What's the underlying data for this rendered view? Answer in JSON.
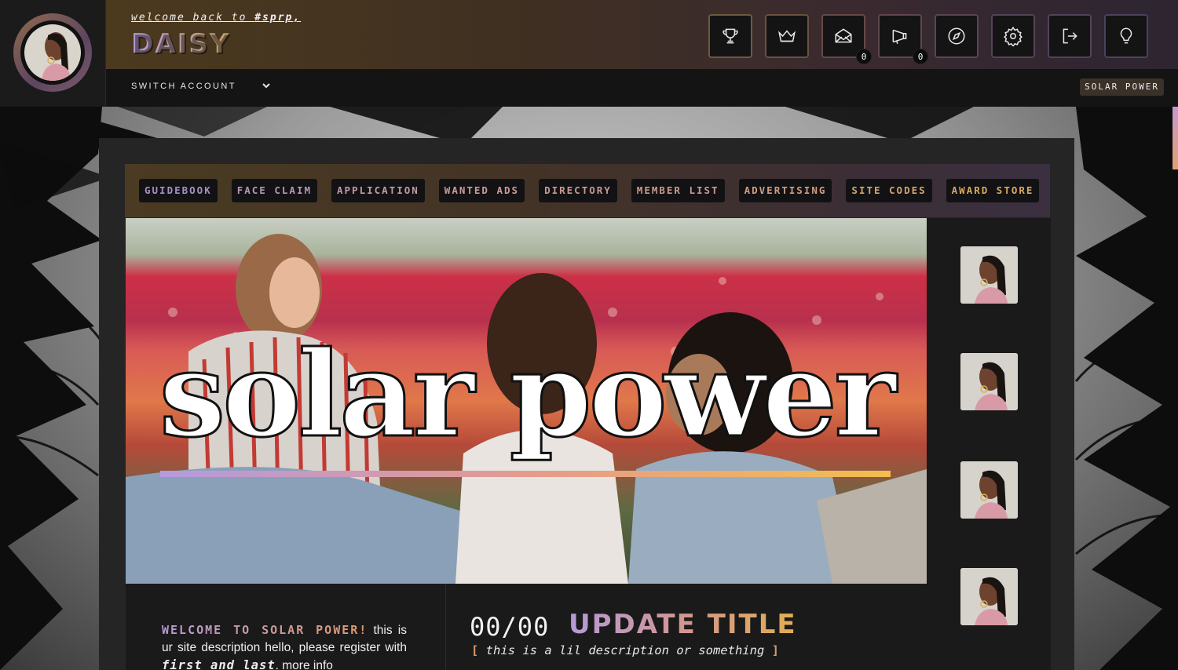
{
  "header": {
    "welcome_prefix": "welcome back to",
    "welcome_site": "#sprp,",
    "username": "DAISY",
    "switch_account": "SWITCH ACCOUNT",
    "site_tag": "SOLAR POWER",
    "icons": [
      {
        "name": "trophy-icon"
      },
      {
        "name": "crown-icon"
      },
      {
        "name": "mail-icon",
        "badge": "0"
      },
      {
        "name": "megaphone-icon",
        "badge": "0"
      },
      {
        "name": "compass-icon"
      },
      {
        "name": "gear-icon"
      },
      {
        "name": "logout-icon"
      },
      {
        "name": "lightbulb-icon"
      }
    ]
  },
  "nav": {
    "items": [
      {
        "label": "GUIDEBOOK",
        "color": "#a591c6"
      },
      {
        "label": "FACE CLAIM",
        "color": "#b798b8"
      },
      {
        "label": "APPLICATION",
        "color": "#c19aa8"
      },
      {
        "label": "WANTED ADS",
        "color": "#cb9b98"
      },
      {
        "label": "DIRECTORY",
        "color": "#c99a92"
      },
      {
        "label": "MEMBER LIST",
        "color": "#cb9a8a"
      },
      {
        "label": "ADVERTISING",
        "color": "#cf9e80"
      },
      {
        "label": "SITE CODES",
        "color": "#d4a470"
      },
      {
        "label": "AWARD STORE",
        "color": "#d9a860"
      }
    ]
  },
  "hero": {
    "title": "solar power"
  },
  "description": {
    "heading": "WELCOME TO SOLAR POWER!",
    "text_1": " this is ur site description hello, please register with ",
    "emphasis": "first and last",
    "text_2": ". more info"
  },
  "update": {
    "date": "00/00",
    "title": "UPDATE TITLE",
    "open_bracket": "[",
    "desc": " this is a lil description or something ",
    "close_bracket": "]"
  },
  "colors": {
    "accent_lavender": "#b59ad8",
    "accent_peach": "#e29a6a",
    "accent_gold": "#e2ad52"
  }
}
